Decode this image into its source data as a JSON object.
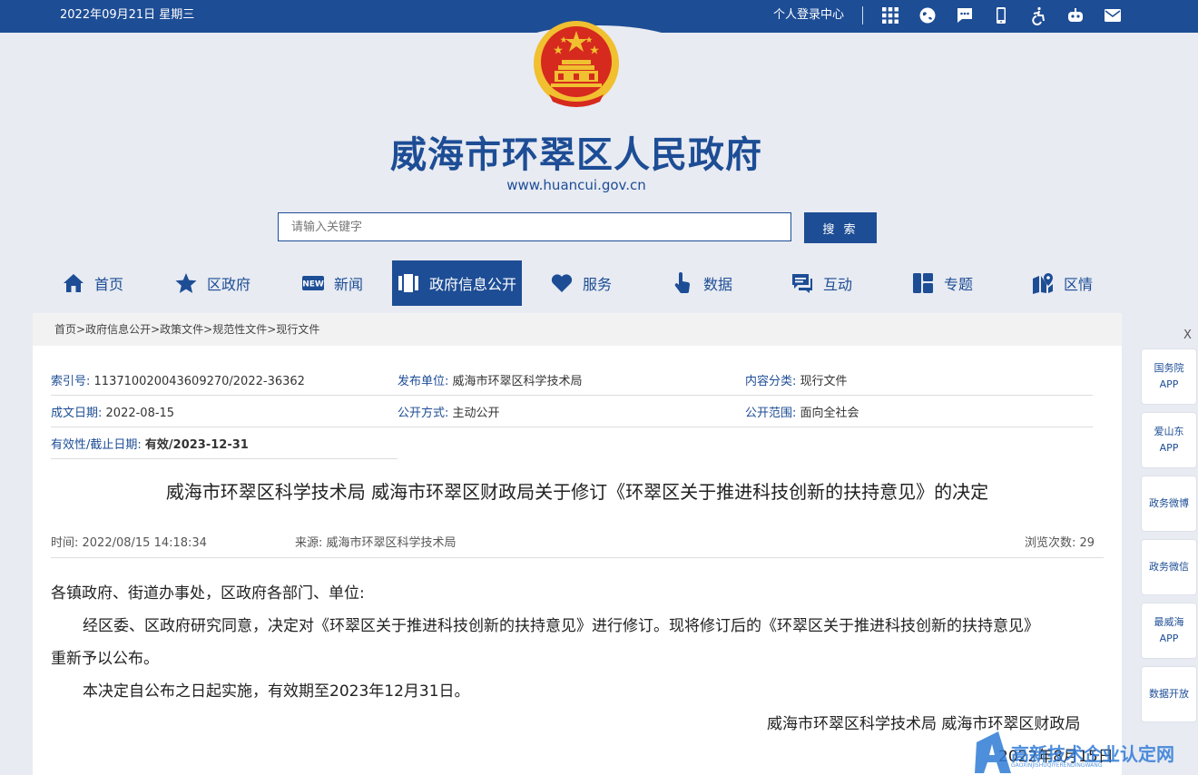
{
  "header": {
    "date": "2022年09月21日 星期三",
    "login": "个人登录中心",
    "icons": [
      "grid-icon",
      "globe-icon",
      "message-icon",
      "mobile-icon",
      "accessibility-icon",
      "robot-icon",
      "mail-icon"
    ]
  },
  "site": {
    "title": "威海市环翠区人民政府",
    "url": "www.huancui.gov.cn"
  },
  "search": {
    "placeholder": "请输入关键字",
    "button": "搜 索"
  },
  "nav": [
    {
      "label": "首页",
      "icon": "home-icon"
    },
    {
      "label": "区政府",
      "icon": "star-icon"
    },
    {
      "label": "新闻",
      "icon": "new-badge-icon"
    },
    {
      "label": "政府信息公开",
      "icon": "columns-icon",
      "active": true
    },
    {
      "label": "服务",
      "icon": "heart-icon"
    },
    {
      "label": "数据",
      "icon": "hand-pointer-icon"
    },
    {
      "label": "互动",
      "icon": "chat-icon"
    },
    {
      "label": "专题",
      "icon": "layout-icon"
    },
    {
      "label": "区情",
      "icon": "map-pin-icon"
    }
  ],
  "breadcrumb": [
    "首页",
    "政府信息公开",
    "政策文件",
    "规范性文件",
    "现行文件"
  ],
  "breadcrumb_sep": ">",
  "meta": {
    "index_label": "索引号:",
    "index_value": "113710020043609270/2022-36362",
    "publisher_label": "发布单位:",
    "publisher_value": "威海市环翠区科学技术局",
    "category_label": "内容分类:",
    "category_value": "现行文件",
    "date_label": "成文日期:",
    "date_value": "2022-08-15",
    "method_label": "公开方式:",
    "method_value": "主动公开",
    "scope_label": "公开范围:",
    "scope_value": "面向全社会",
    "validity_label": "有效性/截止日期:",
    "validity_value": "有效/2023-12-31"
  },
  "doc": {
    "title": "威海市环翠区科学技术局 威海市环翠区财政局关于修订《环翠区关于推进科技创新的扶持意见》的决定",
    "time": "时间:  2022/08/15 14:18:34",
    "source": "来源:  威海市环翠区科学技术局",
    "views": "浏览次数:  29",
    "salutation": "各镇政府、街道办事处，区政府各部门、单位:",
    "para1": "经区委、区政府研究同意，决定对《环翠区关于推进科技创新的扶持意见》进行修订。现将修订后的《环翠区关于推进科技创新的扶持意见》",
    "para1_cont": "重新予以公布。",
    "para2": "本决定自公布之日起实施，有效期至2023年12月31日。",
    "signature": "威海市环翠区科学技术局  威海市环翠区财政局",
    "sign_date": "2022年8月15日"
  },
  "sidebar": {
    "close": "X",
    "items": [
      {
        "line1": "国务院",
        "line2": "APP"
      },
      {
        "line1": "爱山东",
        "line2": "APP"
      },
      {
        "line1": "政务微博",
        "line2": ""
      },
      {
        "line1": "政务微信",
        "line2": ""
      },
      {
        "line1": "最威海",
        "line2": "APP"
      },
      {
        "line1": "数据开放",
        "line2": ""
      }
    ]
  },
  "watermark": {
    "text": "高新技术企业认定网",
    "sub": "GAOXINJISHUQIYERENDINGWANG"
  },
  "colors": {
    "primary": "#1d4d95",
    "background": "#e8ebf2",
    "emblem_red": "#d62a1e",
    "emblem_gold": "#f0c030"
  }
}
